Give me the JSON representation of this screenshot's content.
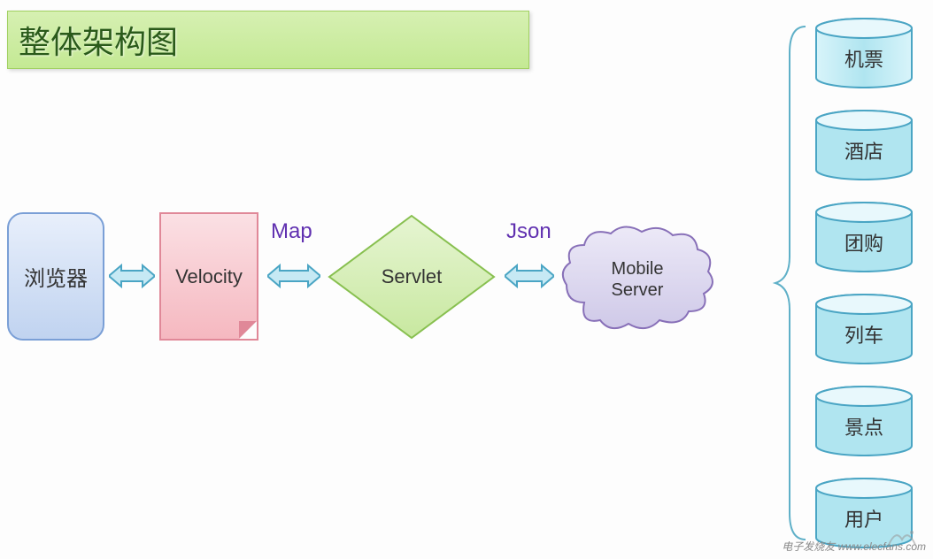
{
  "title": "整体架构图",
  "nodes": {
    "browser": "浏览器",
    "velocity": "Velocity",
    "servlet": "Servlet",
    "mobile_server": "Mobile Server"
  },
  "labels": {
    "map": "Map",
    "json": "Json"
  },
  "services": {
    "flight": "机票",
    "hotel": "酒店",
    "groupbuy": "团购",
    "train": "列车",
    "attraction": "景点",
    "user": "用户"
  },
  "watermark": "电子发烧友  www.elecfans.com",
  "colors": {
    "title_bg_top": "#d6f0b2",
    "title_bg_bottom": "#c4e994",
    "browser_fill": "#c0d3f0",
    "velocity_fill": "#f5b8c0",
    "diamond_fill": "#d6f0b2",
    "cloud_fill": "#e0ddf0",
    "cylinder_fill": "#c4edf4",
    "arrow_fill": "#bfe7f3",
    "label_color": "#6030b0"
  }
}
